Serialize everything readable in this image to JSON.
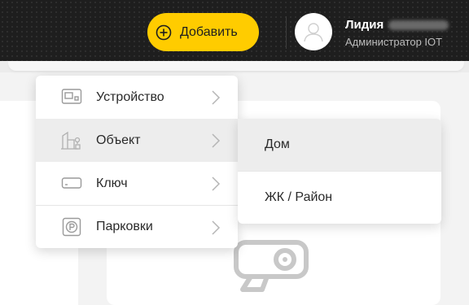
{
  "header": {
    "add_button_label": "Добавить",
    "user": {
      "first_name": "Лидия",
      "role": "Администратор IOT"
    }
  },
  "menu": {
    "items": [
      {
        "label": "Устройство",
        "icon": "device-icon"
      },
      {
        "label": "Объект",
        "icon": "building-icon",
        "active": true
      },
      {
        "label": "Ключ",
        "icon": "key-card-icon"
      },
      {
        "label": "Парковки",
        "icon": "parking-icon"
      }
    ]
  },
  "submenu": {
    "items": [
      {
        "label": "Дом",
        "active": true
      },
      {
        "label": "ЖК / Район"
      }
    ]
  },
  "colors": {
    "accent": "#ffcc00",
    "header_bg": "#1e1e1e",
    "active_row": "#ededed"
  }
}
